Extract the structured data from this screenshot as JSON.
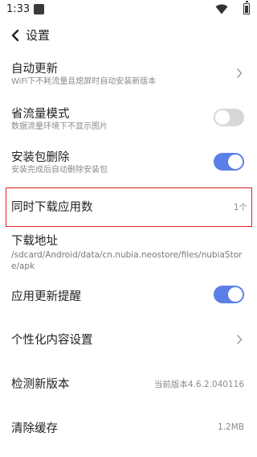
{
  "status_bar": {
    "time": "1:33"
  },
  "header": {
    "title": "设置"
  },
  "settings": {
    "auto_update": {
      "title": "自动更新",
      "subtitle": "WiFi下不耗流量且熄屏时自动安装新版本"
    },
    "data_saver": {
      "title": "省流量模式",
      "subtitle": "数据流量环境下不显示图片",
      "enabled": false
    },
    "delete_package": {
      "title": "安装包删除",
      "subtitle": "安装完成后自动删除安装包",
      "enabled": true
    },
    "concurrent_downloads": {
      "title": "同时下载应用数",
      "value": "1个"
    },
    "download_path": {
      "title": "下载地址",
      "path": "/sdcard/Android/data/cn.nubia.neostore/files/nubiaStore/apk"
    },
    "update_reminder": {
      "title": "应用更新提醒",
      "enabled": true
    },
    "personalization": {
      "title": "个性化内容设置"
    },
    "check_version": {
      "title": "检测新版本",
      "value": "当前版本4.6.2.040116"
    },
    "clear_cache": {
      "title": "清除缓存",
      "value": "1.2MB"
    }
  },
  "colors": {
    "accent": "#5b7fe6",
    "highlight": "#e02020",
    "toggle_off": "#d7d7d7"
  }
}
